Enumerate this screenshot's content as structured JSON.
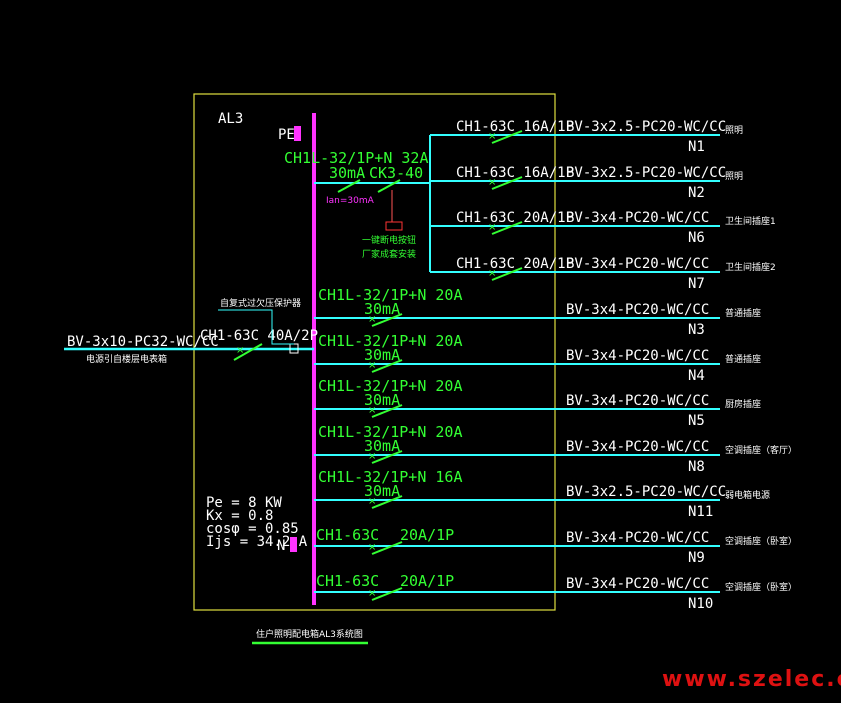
{
  "panel": {
    "name": "AL3",
    "pe_label": "PE",
    "n_label": "N",
    "title": "住户照明配电箱AL3系统图",
    "params": {
      "pe": "Pe = 8 KW",
      "kx": "Kx = 0.8",
      "cos": "cosφ = 0.85",
      "ijs": "Ijs = 34.2 A"
    }
  },
  "incoming": {
    "cable": "BV-3x10-PC32-WC/CC",
    "note": "电源引自楼层电表箱",
    "breaker": "CH1-63C 40A/2P",
    "protector": "自复式过欠压保护器"
  },
  "rcd_group": {
    "breaker": "CH1L-32/1P+N 32A",
    "rcd_current": "30mA",
    "contactor": "CK3-40",
    "ian": "Ian=30mA",
    "note_line1": "一键断电按钮",
    "note_line2": "厂家成套安装"
  },
  "circuits": [
    {
      "breaker": "CH1-63C  16A/1P",
      "cable": "BV-3x2.5-PC20-WC/CC",
      "id": "N1",
      "use": "照明"
    },
    {
      "breaker": "CH1-63C  16A/1P",
      "cable": "BV-3x2.5-PC20-WC/CC",
      "id": "N2",
      "use": "照明"
    },
    {
      "breaker": "CH1-63C  20A/1P",
      "cable": "BV-3x4-PC20-WC/CC",
      "id": "N6",
      "use": "卫生间插座1"
    },
    {
      "breaker": "CH1-63C  20A/1P",
      "cable": "BV-3x4-PC20-WC/CC",
      "id": "N7",
      "use": "卫生间插座2"
    },
    {
      "breaker": "CH1L-32/1P+N 20A",
      "rcd": "30mA",
      "cable": "BV-3x4-PC20-WC/CC",
      "id": "N3",
      "use": "普通插座"
    },
    {
      "breaker": "CH1L-32/1P+N 20A",
      "rcd": "30mA",
      "cable": "BV-3x4-PC20-WC/CC",
      "id": "N4",
      "use": "普通插座"
    },
    {
      "breaker": "CH1L-32/1P+N 20A",
      "rcd": "30mA",
      "cable": "BV-3x4-PC20-WC/CC",
      "id": "N5",
      "use": "厨房插座"
    },
    {
      "breaker": "CH1L-32/1P+N 20A",
      "rcd": "30mA",
      "cable": "BV-3x4-PC20-WC/CC",
      "id": "N8",
      "use": "空调插座（客厅）"
    },
    {
      "breaker": "CH1L-32/1P+N 16A",
      "rcd": "30mA",
      "cable": "BV-3x2.5-PC20-WC/CC",
      "id": "N11",
      "use": "弱电箱电源"
    },
    {
      "breaker": "CH1-63C",
      "rating": "20A/1P",
      "cable": "BV-3x4-PC20-WC/CC",
      "id": "N9",
      "use": "空调插座（卧室）"
    },
    {
      "breaker": "CH1-63C",
      "rating": "20A/1P",
      "cable": "BV-3x4-PC20-WC/CC",
      "id": "N10",
      "use": "空调插座（卧室）"
    }
  ],
  "watermark": "www.szelec.cc",
  "colors": {
    "background": "#000000",
    "frame": "#e0e040",
    "wire": "#33ffff",
    "busbar": "#ff33ff",
    "breaker": "#33ff33",
    "text": "#ffffff",
    "watermark": "#dd1111"
  }
}
